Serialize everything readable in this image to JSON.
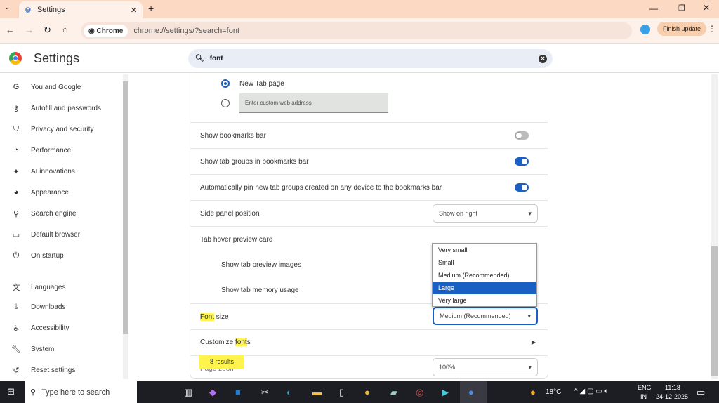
{
  "browser": {
    "tab_title": "Settings",
    "chip": "Chrome",
    "url": "chrome://settings/?search=font",
    "update_button": "Finish update",
    "accent": "#1a5fc2"
  },
  "header": {
    "title": "Settings",
    "search_value": "font"
  },
  "sidebar": {
    "items": [
      {
        "label": "You and Google",
        "icon": "google-icon"
      },
      {
        "label": "Autofill and passwords",
        "icon": "key-icon"
      },
      {
        "label": "Privacy and security",
        "icon": "shield-icon"
      },
      {
        "label": "Performance",
        "icon": "gauge-icon"
      },
      {
        "label": "AI innovations",
        "icon": "sparkle-icon"
      },
      {
        "label": "Appearance",
        "icon": "palette-icon"
      },
      {
        "label": "Search engine",
        "icon": "search-icon"
      },
      {
        "label": "Default browser",
        "icon": "browser-icon"
      },
      {
        "label": "On startup",
        "icon": "power-icon"
      },
      {
        "label": "Languages",
        "icon": "translate-icon"
      },
      {
        "label": "Downloads",
        "icon": "download-icon"
      },
      {
        "label": "Accessibility",
        "icon": "accessibility-icon"
      },
      {
        "label": "System",
        "icon": "wrench-icon"
      },
      {
        "label": "Reset settings",
        "icon": "reset-icon"
      }
    ]
  },
  "main": {
    "new_tab_page": "New Tab page",
    "custom_address_placeholder": "Enter custom web address",
    "show_bookmarks_bar": "Show bookmarks bar",
    "show_tab_groups": "Show tab groups in bookmarks bar",
    "auto_pin": "Automatically pin new tab groups created on any device to the bookmarks bar",
    "side_panel": "Side panel position",
    "side_panel_value": "Show on right",
    "tab_hover": "Tab hover preview card",
    "show_preview_images": "Show tab preview images",
    "show_memory": "Show tab memory usage",
    "font_size_hl": "Font",
    "font_size_rest": " size",
    "font_size_value": "Medium (Recommended)",
    "customize_pre": "Customize ",
    "customize_hl": "font",
    "customize_post": "s",
    "page_zoom": "Page zoom",
    "page_zoom_value": "100%",
    "results_badge": "8 results",
    "font_size_options": [
      "Very small",
      "Small",
      "Medium (Recommended)",
      "Large",
      "Very large"
    ],
    "highlighted_option": "Large"
  },
  "taskbar": {
    "search_placeholder": "Type here to search",
    "weather": "18°C",
    "lang1": "ENG",
    "lang2": "IN",
    "time": "11:18",
    "date": "24-12-2025"
  }
}
